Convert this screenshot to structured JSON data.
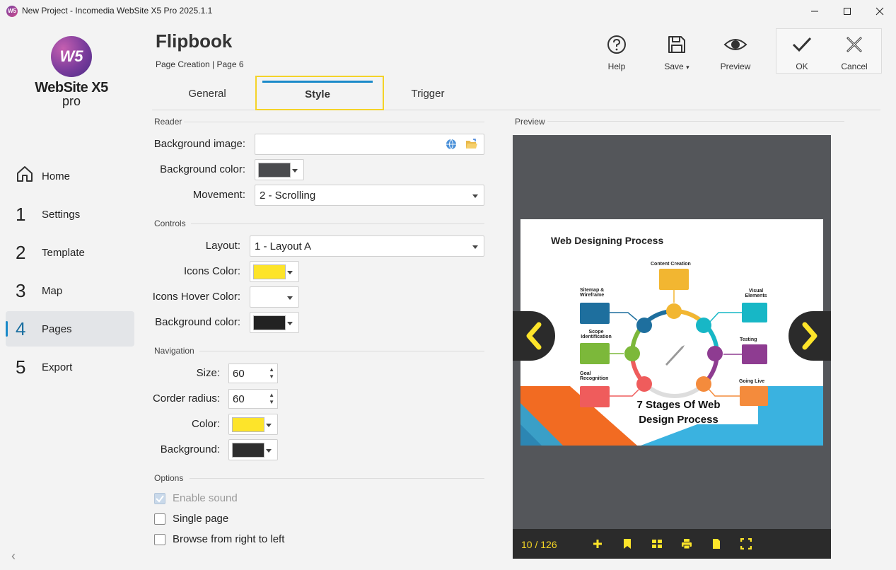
{
  "window": {
    "title": "New Project - Incomedia WebSite X5 Pro 2025.1.1",
    "app_icon_text": "W5"
  },
  "logo": {
    "circle_text": "W5",
    "name": "WebSite X5",
    "edition": "pro"
  },
  "sidebar": {
    "items": [
      {
        "num": "",
        "label": "Home",
        "icon": "home-icon"
      },
      {
        "num": "1",
        "label": "Settings"
      },
      {
        "num": "2",
        "label": "Template"
      },
      {
        "num": "3",
        "label": "Map"
      },
      {
        "num": "4",
        "label": "Pages",
        "active": true
      },
      {
        "num": "5",
        "label": "Export"
      }
    ],
    "collapse": "‹"
  },
  "header": {
    "title": "Flipbook",
    "subtitle": "Page Creation | Page 6"
  },
  "toolbar": {
    "help": "Help",
    "save": "Save",
    "preview": "Preview",
    "ok": "OK",
    "cancel": "Cancel"
  },
  "tabs": {
    "general": "General",
    "style": "Style",
    "trigger": "Trigger"
  },
  "reader": {
    "section": "Reader",
    "bg_image_label": "Background image:",
    "bg_image_value": "",
    "bg_color_label": "Background color:",
    "bg_color": "#4a4b4e",
    "movement_label": "Movement:",
    "movement_value": "2 - Scrolling"
  },
  "controls": {
    "section": "Controls",
    "layout_label": "Layout:",
    "layout_value": "1 - Layout A",
    "icons_color_label": "Icons Color:",
    "icons_color": "#fde42a",
    "icons_hover_label": "Icons Hover Color:",
    "icons_hover_color": "#ffffff",
    "bg_color_label": "Background color:",
    "bg_color": "#222222"
  },
  "navigation": {
    "section": "Navigation",
    "size_label": "Size:",
    "size_value": "60",
    "radius_label": "Corder radius:",
    "radius_value": "60",
    "color_label": "Color:",
    "color": "#fde42a",
    "background_label": "Background:",
    "background": "#2d2d2d"
  },
  "options": {
    "section": "Options",
    "enable_sound": "Enable sound",
    "single_page": "Single page",
    "rtl": "Browse from right to left"
  },
  "preview": {
    "label": "Preview",
    "page_counter": "10 / 126",
    "infographic": {
      "title": "Web Designing Process",
      "center_line1": "7 Stages Of Web",
      "center_line2": "Design Process",
      "stages": [
        {
          "name": "Content Creation",
          "color": "#f2b631"
        },
        {
          "name": "Visual Elements",
          "color": "#17b7c6"
        },
        {
          "name": "Testing",
          "color": "#8e3c91"
        },
        {
          "name": "Going Live",
          "color": "#f48b3c"
        },
        {
          "name": "Goal Recognition",
          "color": "#ef5c5c"
        },
        {
          "name": "Scope Identification",
          "color": "#7cb83a"
        },
        {
          "name": "Sitemap & Wireframe",
          "color": "#1e6f9e"
        }
      ]
    }
  }
}
